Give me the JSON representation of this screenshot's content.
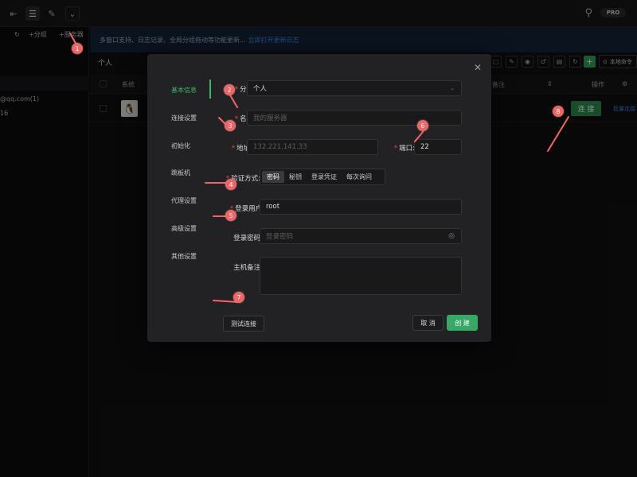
{
  "topbar": {
    "buttons": [
      "tab-icon",
      "list-icon",
      "pen-icon",
      "chevron-down-icon"
    ],
    "search_icon": "search-icon",
    "pro_badge": "PRO"
  },
  "left": {
    "refresh_icon": "refresh-icon",
    "add_group_label": "+分组",
    "add_server_label": "+服务器",
    "email_fragment": "@qq.com(1)",
    "count_fragment": "16"
  },
  "notice": {
    "text": "多窗口支持、日志记录、全局分组拖动等功能更新... ",
    "link": "立即打开更新日志"
  },
  "main": {
    "group_title": "个人",
    "local_terminal_label": "本地命令",
    "columns": {
      "system": "系统",
      "remark": "备注",
      "actions": "操作"
    },
    "row": {
      "os_icon": "linux-icon",
      "connect_label": "连 接",
      "more_label": "批量连接"
    }
  },
  "dialog": {
    "nav": [
      "基本信息",
      "连接设置",
      "初始化",
      "跳板机",
      "代理设置",
      "高级设置",
      "其他设置"
    ],
    "active_nav": 0,
    "labels": {
      "group": "分组:",
      "name": "名称:",
      "address": "地址:",
      "port": "端口:",
      "auth": "验证方式:",
      "user": "登录用户:",
      "password": "登录密码:",
      "remark": "主机备注:"
    },
    "values": {
      "group": "个人",
      "name_placeholder": "我的服务器",
      "address_placeholder": "132.221.141.33",
      "port": "22",
      "user": "root",
      "password_placeholder": "登录密码"
    },
    "auth_options": [
      "密码",
      "秘钥",
      "登录凭证",
      "每次询问"
    ],
    "auth_active": 0,
    "buttons": {
      "test": "测试连接",
      "cancel": "取 消",
      "create": "创 建"
    }
  },
  "annotations": [
    "1",
    "2",
    "3",
    "4",
    "5",
    "6",
    "7",
    "8"
  ],
  "colors": {
    "accent_green": "#37a865",
    "marker_red": "#f26565",
    "link_blue": "#3d8df0"
  }
}
